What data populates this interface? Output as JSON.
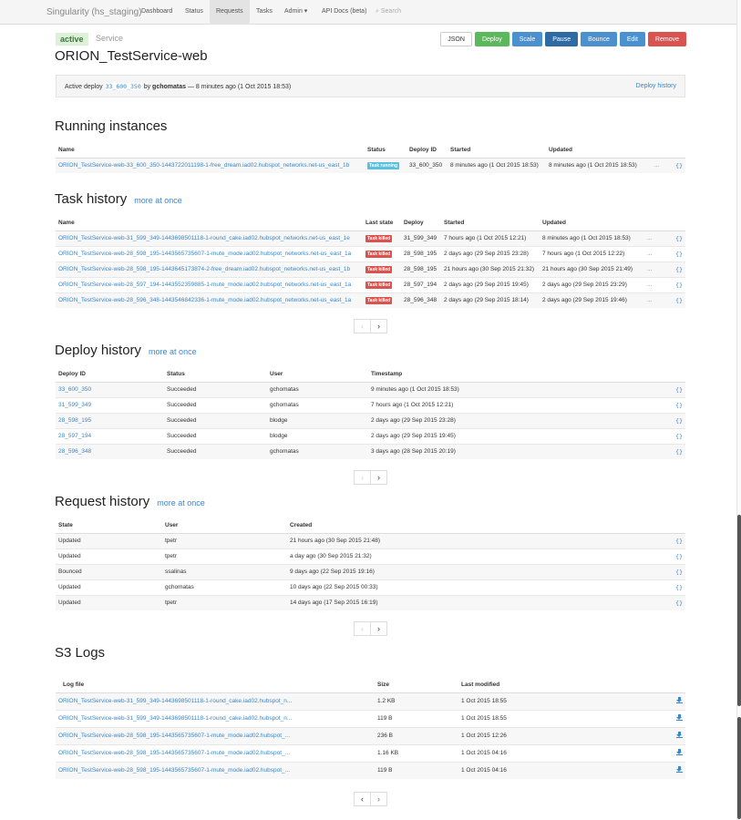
{
  "nav": {
    "brand": "Singularity (hs_staging)",
    "items": [
      "Dashboard",
      "Status",
      "Requests",
      "Tasks",
      "Admin ▾",
      "API Docs (beta)"
    ],
    "search_placeholder": "Search"
  },
  "header": {
    "state": "active",
    "type": "Service",
    "title": "ORION_TestService-web",
    "buttons": [
      "JSON",
      "Deploy",
      "Scale",
      "Pause",
      "Bounce",
      "Edit",
      "Remove"
    ]
  },
  "active_deploy": {
    "prefix": "Active deploy",
    "deploy_id": "33_600_350",
    "by": "by",
    "user": "gchomatas",
    "suffix": "— 8 minutes ago (1 Oct 2015 18:53)",
    "history_link": "Deploy history"
  },
  "running": {
    "title": "Running instances",
    "columns": [
      "Name",
      "Status",
      "Deploy ID",
      "Started",
      "Updated"
    ],
    "rows": [
      {
        "name": "ORION_TestService-web-33_600_350-1443722011198-1-free_dream.iad02.hubspot_networks.net-us_east_1b",
        "status": "Task running",
        "deploy": "33_600_350",
        "started": "8 minutes ago (1 Oct 2015 18:53)",
        "updated": "8 minutes ago (1 Oct 2015 18:53)",
        "dots": "...",
        "json": "{}"
      }
    ]
  },
  "task_history": {
    "title": "Task history",
    "more": "more at once",
    "columns": [
      "Name",
      "Last state",
      "Deploy",
      "Started",
      "Updated"
    ],
    "rows": [
      {
        "name": "ORION_TestService-web-31_599_349-1443698501118-1-round_cake.iad02.hubspot_networks.net-us_east_1e",
        "state": "Task killed",
        "deploy": "31_599_349",
        "started": "7 hours ago (1 Oct 2015 12:21)",
        "updated": "8 minutes ago (1 Oct 2015 18:53)",
        "dots": "...",
        "json": "{}"
      },
      {
        "name": "ORION_TestService-web-28_598_195-1443565735607-1-mute_mode.iad02.hubspot_networks.net-us_east_1a",
        "state": "Task killed",
        "deploy": "28_598_195",
        "started": "2 days ago (29 Sep 2015 23:28)",
        "updated": "7 hours ago (1 Oct 2015 12:22)",
        "dots": "...",
        "json": "{}"
      },
      {
        "name": "ORION_TestService-web-28_598_195-1443645173874-2-free_dream.iad02.hubspot_networks.net-us_east_1b",
        "state": "Task killed",
        "deploy": "28_598_195",
        "started": "21 hours ago (30 Sep 2015 21:32)",
        "updated": "21 hours ago (30 Sep 2015 21:49)",
        "dots": "...",
        "json": "{}"
      },
      {
        "name": "ORION_TestService-web-28_597_194-1443552359885-1-mute_mode.iad02.hubspot_networks.net-us_east_1a",
        "state": "Task killed",
        "deploy": "28_597_194",
        "started": "2 days ago (29 Sep 2015 19:45)",
        "updated": "2 days ago (29 Sep 2015 23:29)",
        "dots": "...",
        "json": "{}"
      },
      {
        "name": "ORION_TestService-web-28_596_348-1443546842336-1-mute_mode.iad02.hubspot_networks.net-us_east_1a",
        "state": "Task killed",
        "deploy": "28_596_348",
        "started": "2 days ago (29 Sep 2015 18:14)",
        "updated": "2 days ago (29 Sep 2015 19:46)",
        "dots": "...",
        "json": "{}"
      }
    ]
  },
  "deploy_history": {
    "title": "Deploy history",
    "more": "more at once",
    "columns": [
      "Deploy ID",
      "Status",
      "User",
      "Timestamp"
    ],
    "rows": [
      {
        "id": "33_600_350",
        "status": "Succeeded",
        "user": "gchomatas",
        "ts": "9 minutes ago (1 Oct 2015 18:53)",
        "json": "{}"
      },
      {
        "id": "31_599_349",
        "status": "Succeeded",
        "user": "gchomatas",
        "ts": "7 hours ago (1 Oct 2015 12:21)",
        "json": "{}"
      },
      {
        "id": "28_598_195",
        "status": "Succeeded",
        "user": "blodge",
        "ts": "2 days ago (29 Sep 2015 23:28)",
        "json": "{}"
      },
      {
        "id": "28_597_194",
        "status": "Succeeded",
        "user": "blodge",
        "ts": "2 days ago (29 Sep 2015 19:45)",
        "json": "{}"
      },
      {
        "id": "28_596_348",
        "status": "Succeeded",
        "user": "gchomatas",
        "ts": "3 days ago (28 Sep 2015 20:19)",
        "json": "{}"
      }
    ]
  },
  "request_history": {
    "title": "Request history",
    "more": "more at once",
    "columns": [
      "State",
      "User",
      "Created"
    ],
    "rows": [
      {
        "state": "Updated",
        "user": "tpetr",
        "created": "21 hours ago (30 Sep 2015 21:48)",
        "json": "{}"
      },
      {
        "state": "Updated",
        "user": "tpetr",
        "created": "a day ago (30 Sep 2015 21:32)",
        "json": "{}"
      },
      {
        "state": "Bounced",
        "user": "ssalinas",
        "created": "9 days ago (22 Sep 2015 19:16)",
        "json": "{}"
      },
      {
        "state": "Updated",
        "user": "gchomatas",
        "created": "10 days ago (22 Sep 2015 00:33)",
        "json": "{}"
      },
      {
        "state": "Updated",
        "user": "tpetr",
        "created": "14 days ago (17 Sep 2015 16:19)",
        "json": "{}"
      }
    ]
  },
  "s3_logs": {
    "title": "S3 Logs",
    "columns": [
      "Log file",
      "Size",
      "Last modified"
    ],
    "rows": [
      {
        "file": "ORION_TestService-web-31_599_349-1443698501118-1-round_cake.iad02.hubspot_n...",
        "size": "1.2 KB",
        "modified": "1 Oct 2015 18:55"
      },
      {
        "file": "ORION_TestService-web-31_599_349-1443698501118-1-round_cake.iad02.hubspot_n...",
        "size": "119 B",
        "modified": "1 Oct 2015 18:55"
      },
      {
        "file": "ORION_TestService-web-28_598_195-1443565735607-1-mute_mode.iad02.hubspot_...",
        "size": "236 B",
        "modified": "1 Oct 2015 12:26"
      },
      {
        "file": "ORION_TestService-web-28_598_195-1443565735607-1-mute_mode.iad02.hubspot_...",
        "size": "1.16 KB",
        "modified": "1 Oct 2015 04:16"
      },
      {
        "file": "ORION_TestService-web-28_598_195-1443565735607-1-mute_mode.iad02.hubspot_...",
        "size": "119 B",
        "modified": "1 Oct 2015 04:16"
      }
    ]
  },
  "pager": {
    "prev": "‹",
    "next": "›"
  },
  "icons": {
    "search": "search-icon",
    "download": "download-icon"
  }
}
